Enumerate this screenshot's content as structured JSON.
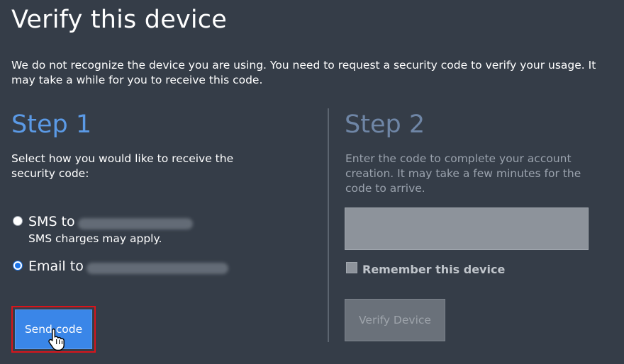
{
  "page": {
    "title": "Verify this device",
    "intro": "We do not recognize the device you are using. You need to request a security code to verify your usage. It may take a while for you to receive this code."
  },
  "step1": {
    "heading": "Step 1",
    "description": "Select how you would like to receive the security code:",
    "options": [
      {
        "label": "SMS to",
        "note": "SMS charges may apply.",
        "selected": false
      },
      {
        "label": "Email to",
        "selected": true
      }
    ],
    "send_button": "Send code"
  },
  "step2": {
    "heading": "Step 2",
    "description": "Enter the code to complete your account creation. It may take a few minutes for the code to arrive.",
    "code_input_value": "",
    "remember_label": "Remember this device",
    "remember_checked": false,
    "verify_button": "Verify Device"
  },
  "colors": {
    "background": "#353d48",
    "step1_heading": "#5b9ae6",
    "step2_heading": "#6f86a6",
    "primary_button": "#3a86e8",
    "highlight_border": "#d9151b"
  },
  "icons": {
    "cursor": "hand-pointer-icon"
  }
}
